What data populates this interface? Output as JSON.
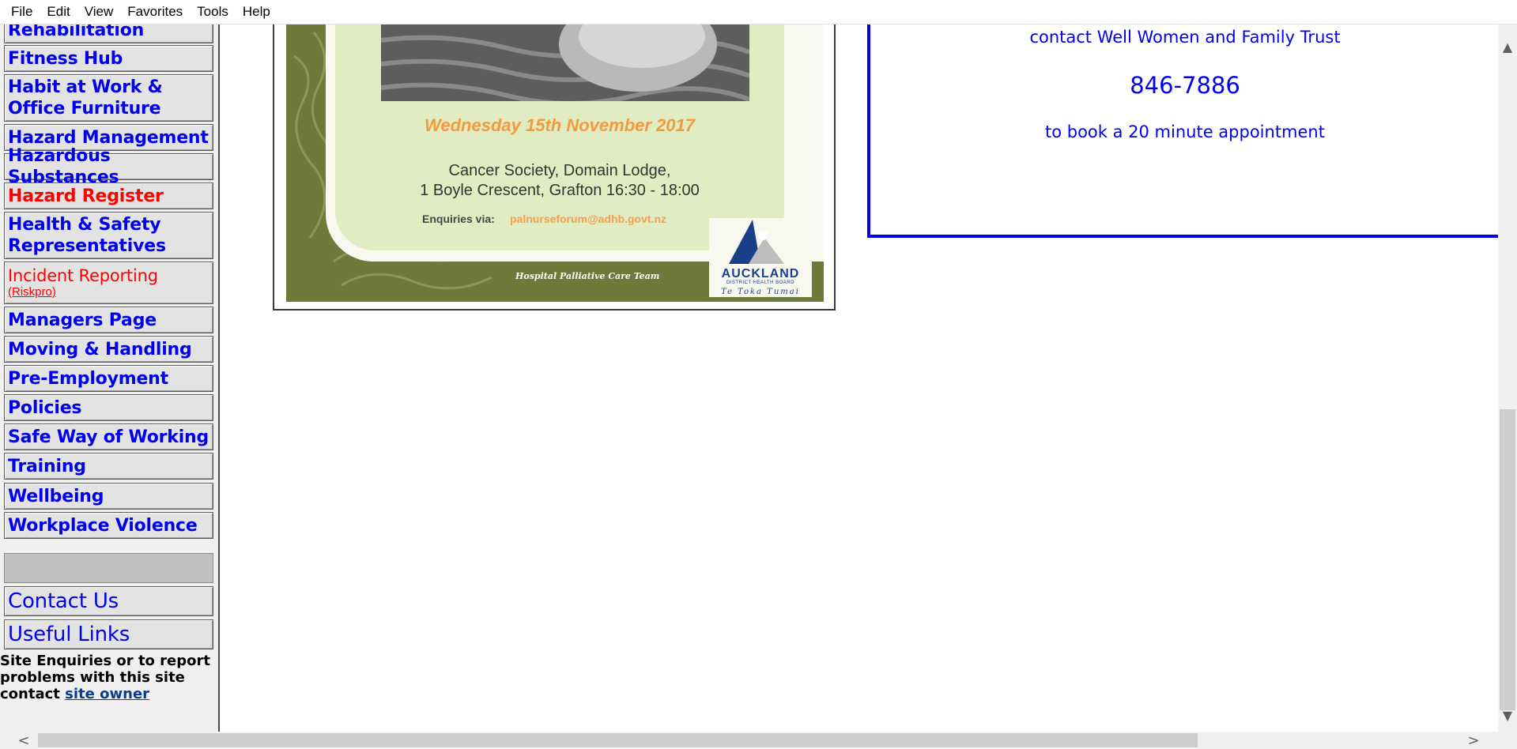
{
  "menubar": {
    "items": [
      "File",
      "Edit",
      "View",
      "Favorites",
      "Tools",
      "Help"
    ]
  },
  "nav": {
    "items": [
      {
        "label": "Rehabilitation",
        "color": "#0000ee"
      },
      {
        "label": "Fitness Hub",
        "color": "#0000ee"
      },
      {
        "label": "Habit at Work & Office Furniture",
        "color": "#0000ee"
      },
      {
        "label": "Hazard Management",
        "color": "#0000ee"
      },
      {
        "label": "Hazardous Substances",
        "color": "#0000ee"
      },
      {
        "label": "Hazard Register",
        "color": "#ff0000"
      },
      {
        "label": "Health & Safety Representatives",
        "color": "#0000ee"
      },
      {
        "label": "Incident Reporting",
        "sub": "(Riskpro)",
        "color": "#ff0000"
      },
      {
        "label": "Managers Page",
        "color": "#0000ee"
      },
      {
        "label": "Moving & Handling",
        "color": "#0000ee"
      },
      {
        "label": "Pre-Employment",
        "color": "#0000ee"
      },
      {
        "label": "Policies",
        "color": "#0000ee"
      },
      {
        "label": "Safe Way of Working",
        "color": "#0000ee"
      },
      {
        "label": "Training",
        "color": "#0000ee"
      },
      {
        "label": "Wellbeing",
        "color": "#0000ee"
      },
      {
        "label": "Workplace Violence",
        "color": "#0000ee"
      }
    ],
    "contact_us": "Contact Us",
    "useful_links": "Useful Links"
  },
  "site_enquiries": {
    "text": "Site Enquiries or  to report problems with this site contact",
    "link": "site owner"
  },
  "poster": {
    "date": "Wednesday 15th November 2017",
    "venue_line1": "Cancer Society, Domain Lodge,",
    "venue_line2": "1 Boyle Crescent, Grafton 16:30 - 18:00",
    "enquiries_label": "Enquiries via:",
    "enquiries_email": "palnurseforum@adhb.govt.nz",
    "team": "Hospital Palliative Care Team",
    "logo_name": "AUCKLAND",
    "logo_sub": "DISTRICT HEALTH BOARD",
    "logo_maori": "Te Toka Tumai"
  },
  "infobox": {
    "contact": "contact Well Women and Family Trust",
    "phone": "846-7886",
    "book": "to book a 20 minute  appointment"
  },
  "scrollbars": {
    "up_icon": "▲",
    "down_icon": "▼",
    "left_icon": "<",
    "right_icon": ">"
  }
}
